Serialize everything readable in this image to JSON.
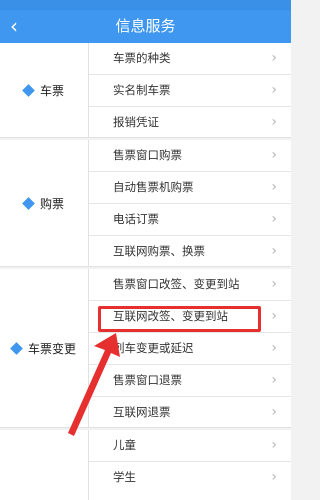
{
  "header": {
    "back_icon": "chevron-left-icon",
    "title": "信息服务"
  },
  "groups": [
    {
      "label": "车票",
      "items": [
        "车票的种类",
        "实名制车票",
        "报销凭证"
      ]
    },
    {
      "label": "购票",
      "items": [
        "售票窗口购票",
        "自动售票机购票",
        "电话订票",
        "互联网购票、换票"
      ]
    },
    {
      "label": "车票变更",
      "items": [
        "售票窗口改签、变更到站",
        "互联网改签、变更到站",
        "列车变更或延迟",
        "售票窗口退票",
        "互联网退票"
      ]
    },
    {
      "label": "",
      "items": [
        "儿童",
        "学生"
      ]
    }
  ],
  "highlighted_item": "互联网改签、变更到站",
  "colors": {
    "accent": "#3f97ef",
    "highlight": "#e63030"
  }
}
